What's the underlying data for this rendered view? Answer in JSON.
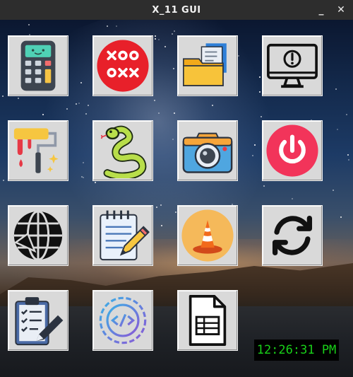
{
  "window": {
    "title": "X_11 GUI",
    "minimize_glyph": "_",
    "close_glyph": "✕"
  },
  "desktop": {
    "background": "night-sky-with-milky-way-over-canyon-and-river",
    "apps": [
      {
        "icon": "calculator-icon"
      },
      {
        "icon": "tic-tac-toe-icon"
      },
      {
        "icon": "folder-files-icon"
      },
      {
        "icon": "monitor-alert-icon"
      },
      {
        "icon": "paint-roller-icon"
      },
      {
        "icon": "python-snake-icon"
      },
      {
        "icon": "camera-icon"
      },
      {
        "icon": "power-icon"
      },
      {
        "icon": "globe-navigation-icon"
      },
      {
        "icon": "notepad-pencil-icon"
      },
      {
        "icon": "vlc-cone-icon"
      },
      {
        "icon": "refresh-icon"
      },
      {
        "icon": "clipboard-checklist-icon"
      },
      {
        "icon": "code-gear-icon"
      },
      {
        "icon": "spreadsheet-document-icon"
      }
    ],
    "clock_time": "12:26:31 PM"
  },
  "colors": {
    "clock_text": "#19d119",
    "clock_bg": "#000000",
    "tile_bg": "#d9d9d9",
    "titlebar_bg": "#2d2d2d"
  }
}
